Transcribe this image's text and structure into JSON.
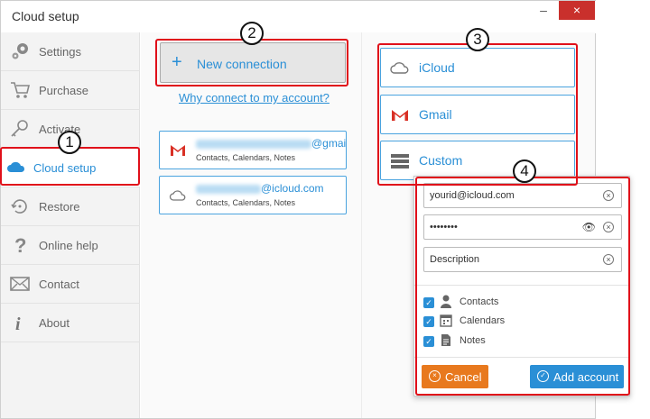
{
  "window": {
    "title": "Cloud setup",
    "minimize": "–",
    "close": "×"
  },
  "sidebar": {
    "items": [
      {
        "label": "Settings",
        "icon": "gears-icon"
      },
      {
        "label": "Purchase",
        "icon": "cart-icon"
      },
      {
        "label": "Activate",
        "icon": "key-icon"
      },
      {
        "label": "Cloud setup",
        "icon": "cloud-icon",
        "active": true
      },
      {
        "label": "Restore",
        "icon": "restore-icon"
      },
      {
        "label": "Online help",
        "icon": "question-icon"
      },
      {
        "label": "Contact",
        "icon": "envelope-icon"
      },
      {
        "label": "About",
        "icon": "info-icon"
      }
    ]
  },
  "connections": {
    "new_label": "New connection",
    "plus": "+",
    "why_link": "Why connect to my account?",
    "accounts": [
      {
        "email_suffix": "@gmai",
        "detail": "Contacts, Calendars, Notes",
        "icon": "gmail-icon"
      },
      {
        "email_suffix": "@icloud.com",
        "detail": "Contacts, Calendars, Notes",
        "icon": "cloud-outline-icon"
      }
    ]
  },
  "services": [
    {
      "label": "iCloud",
      "icon": "cloud-outline-icon"
    },
    {
      "label": "Gmail",
      "icon": "gmail-icon"
    },
    {
      "label": "Custom",
      "icon": "server-icon"
    }
  ],
  "popup": {
    "email_value": "yourid@icloud.com",
    "password_value": "••••••••",
    "description_value": "Description",
    "clear": "×",
    "eye": "👁",
    "checks": [
      {
        "label": "Contacts",
        "checked": true
      },
      {
        "label": "Calendars",
        "checked": true
      },
      {
        "label": "Notes",
        "checked": true
      }
    ],
    "check_mark": "✓",
    "cancel_label": "Cancel",
    "add_label": "Add account"
  },
  "callouts": [
    "1",
    "2",
    "3",
    "4"
  ],
  "colors": {
    "accent": "#2a8fd6",
    "highlight": "#e0101a",
    "cancel": "#e8791e",
    "close": "#c9302c"
  }
}
